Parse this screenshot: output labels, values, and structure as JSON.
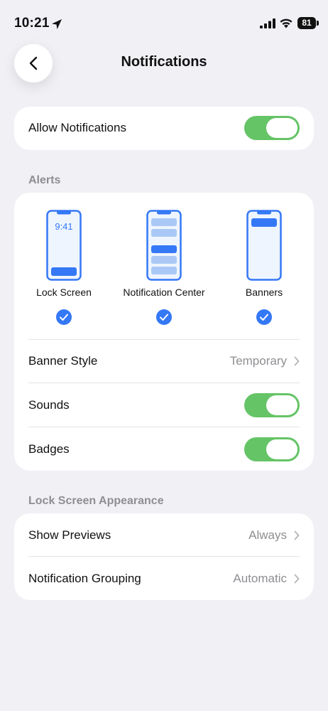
{
  "status_bar": {
    "time": "10:21",
    "battery": "81"
  },
  "nav": {
    "title": "Notifications"
  },
  "allow_notifications": {
    "label": "Allow Notifications",
    "on": true
  },
  "alerts": {
    "header": "Alerts",
    "options": [
      {
        "label": "Lock Screen",
        "selected": true,
        "preview_time": "9:41"
      },
      {
        "label": "Notification Center",
        "selected": true
      },
      {
        "label": "Banners",
        "selected": true
      }
    ],
    "banner_style": {
      "label": "Banner Style",
      "value": "Temporary"
    },
    "sounds": {
      "label": "Sounds",
      "on": true
    },
    "badges": {
      "label": "Badges",
      "on": true
    }
  },
  "lock_screen_appearance": {
    "header": "Lock Screen Appearance",
    "show_previews": {
      "label": "Show Previews",
      "value": "Always"
    },
    "notification_grouping": {
      "label": "Notification Grouping",
      "value": "Automatic"
    }
  },
  "colors": {
    "accent_blue": "#3478F6",
    "toggle_green": "#65C466",
    "background": "#F0F0F5"
  }
}
